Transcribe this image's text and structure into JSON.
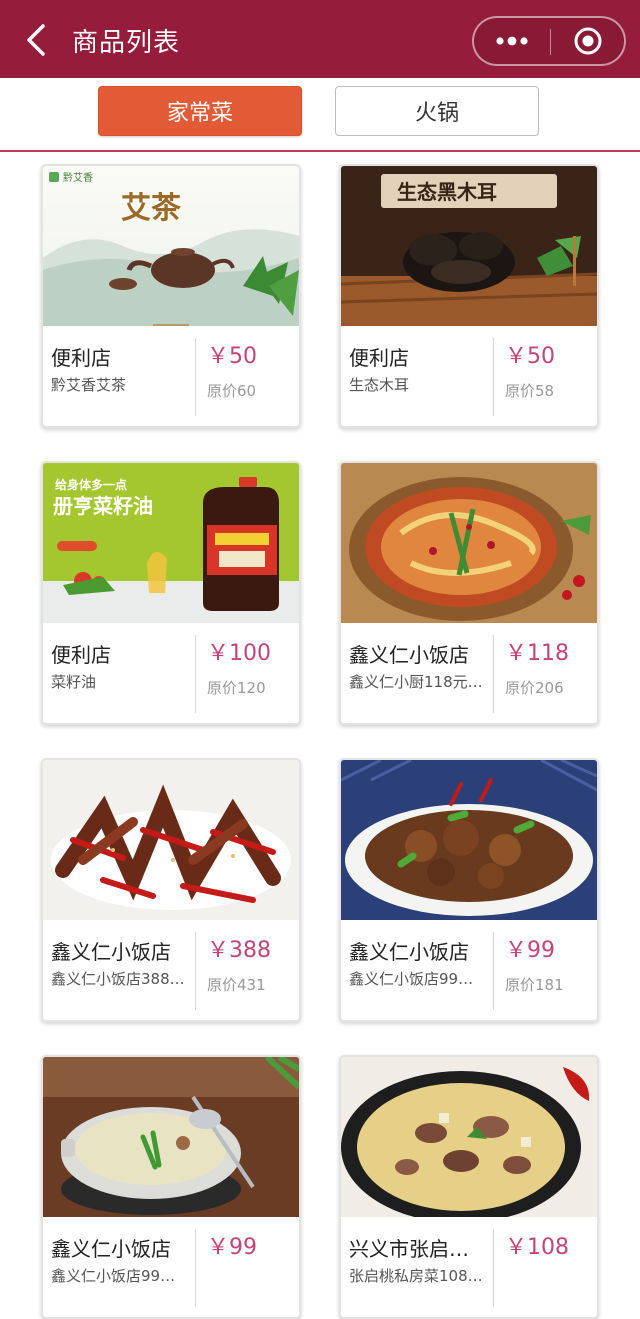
{
  "header": {
    "title": "商品列表",
    "back_icon": "chevron-left-icon",
    "more_icon": "more-dots-icon",
    "close_icon": "target-circle-icon",
    "bg_color": "#951c3a"
  },
  "tabs": [
    {
      "label": "家常菜",
      "active": true
    },
    {
      "label": "火锅",
      "active": false
    }
  ],
  "accent_color": "#e25a36",
  "price_color": "#c3447a",
  "products": [
    {
      "store": "便利店",
      "name": "黔艾香艾茶",
      "price": "￥50",
      "original": "原价60",
      "image_text": "艾茶",
      "brand_text": "黔艾香"
    },
    {
      "store": "便利店",
      "name": "生态木耳",
      "price": "￥50",
      "original": "原价58",
      "image_text": "生态黑木耳"
    },
    {
      "store": "便利店",
      "name": "菜籽油",
      "price": "￥100",
      "original": "原价120",
      "image_text": "册亨菜籽油",
      "image_subtext": "给身体多一点"
    },
    {
      "store": "鑫义仁小饭店",
      "name": "鑫义仁小厨118元…",
      "price": "￥118",
      "original": "原价206"
    },
    {
      "store": "鑫义仁小饭店",
      "name": "鑫义仁小饭店388…",
      "price": "￥388",
      "original": "原价431"
    },
    {
      "store": "鑫义仁小饭店",
      "name": "鑫义仁小饭店99…",
      "price": "￥99",
      "original": "原价181"
    },
    {
      "store": "鑫义仁小饭店",
      "name": "鑫义仁小饭店99…",
      "price": "￥99",
      "original": ""
    },
    {
      "store": "兴义市张启…",
      "name": "张启桃私房菜108…",
      "price": "￥108",
      "original": ""
    }
  ]
}
